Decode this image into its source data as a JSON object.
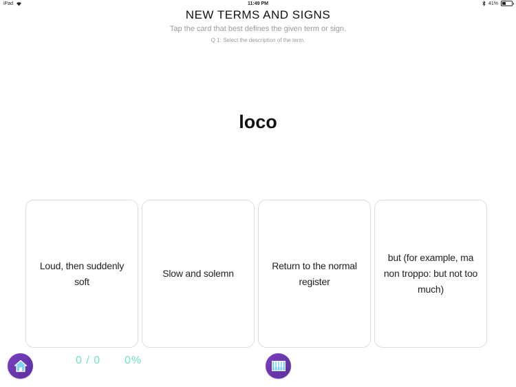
{
  "status_bar": {
    "device": "iPad",
    "time": "11:49 PM",
    "battery_percent": "41%",
    "battery_level": 0.41
  },
  "header": {
    "title": "NEW TERMS AND SIGNS",
    "subtitle": "Tap the card that best defines the given term or sign.",
    "instruction": "Q 1: Select the description of the term."
  },
  "question": {
    "term": "loco"
  },
  "cards": [
    {
      "label": "Loud, then suddenly soft"
    },
    {
      "label": "Slow and solemn"
    },
    {
      "label": "Return to the normal register"
    },
    {
      "label": "but (for example, ma non troppo: but not too much)"
    }
  ],
  "footer": {
    "score": "0 / 0",
    "percent": "0%",
    "home_icon": "home-icon",
    "piano_icon": "piano-keyboard-icon"
  },
  "colors": {
    "accent_purple": "#6a35b0",
    "score_teal": "#6fe3c6",
    "card_border": "#dcdcdc"
  }
}
